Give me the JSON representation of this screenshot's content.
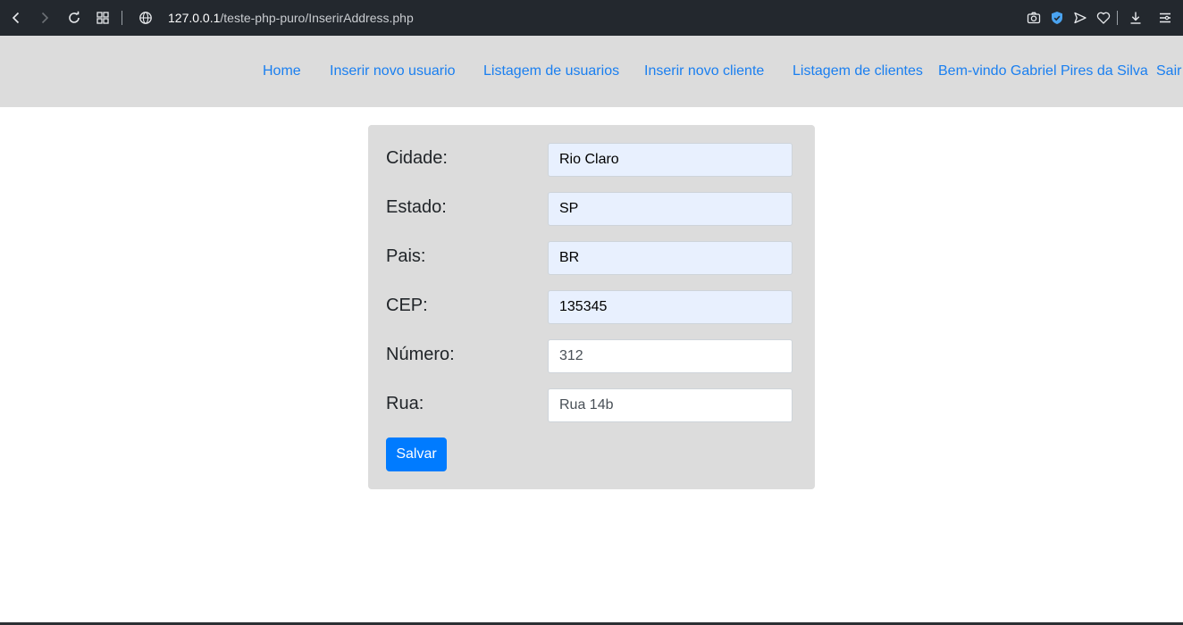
{
  "browser": {
    "url_host": "127.0.0.1",
    "url_path": "/teste-php-puro/InserirAddress.php",
    "left_icons": [
      "back-arrow-icon",
      "forward-arrow-icon",
      "reload-icon",
      "tabs-grid-icon",
      "globe-icon"
    ],
    "right_icons": [
      "camera-icon",
      "shield-icon",
      "send-icon",
      "heart-icon",
      "download-icon",
      "menu-icon"
    ]
  },
  "nav": {
    "home": "Home",
    "insert_user": "Inserir novo usuario",
    "list_users": "Listagem de usuarios",
    "insert_client": "Inserir novo cliente",
    "list_clients": "Listagem de clientes",
    "welcome": "Bem-vindo Gabriel Pires da Silva",
    "logout": "Sair"
  },
  "form": {
    "fields": [
      {
        "label": "Cidade:",
        "value": "Rio Claro"
      },
      {
        "label": "Estado:",
        "value": "SP"
      },
      {
        "label": "Pais:",
        "value": "BR"
      },
      {
        "label": "CEP:",
        "value": "135345"
      },
      {
        "label": "Número:",
        "value": "312"
      },
      {
        "label": "Rua:",
        "value": "Rua 14b"
      }
    ],
    "submit_label": "Salvar"
  },
  "colors": {
    "browser_bar": "#23282e",
    "navbar_bg": "#dcdcdc",
    "link": "#1a7ff0",
    "card_bg": "#dcdcdc",
    "autofill_bg": "#e8f0fe",
    "primary_button": "#007bff",
    "shield_accent": "#4aa3f0"
  }
}
